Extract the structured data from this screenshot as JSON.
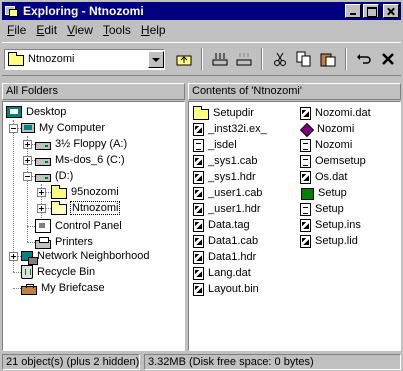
{
  "window": {
    "title": "Exploring - Ntnozomi"
  },
  "menu": [
    {
      "label": "File",
      "key": "F",
      "rest": "ile"
    },
    {
      "label": "Edit",
      "key": "E",
      "rest": "dit"
    },
    {
      "label": "View",
      "key": "V",
      "rest": "iew"
    },
    {
      "label": "Tools",
      "key": "T",
      "rest": "ools"
    },
    {
      "label": "Help",
      "key": "H",
      "rest": "elp"
    }
  ],
  "toolbar": {
    "location": "Ntnozomi",
    "buttons": [
      "up-folder-icon",
      "map-drive-icon",
      "disconnect-drive-icon",
      "cut-icon",
      "copy-icon",
      "paste-icon",
      "undo-icon",
      "delete-icon"
    ]
  },
  "panes": {
    "left_header": "All Folders",
    "right_header": "Contents of 'Ntnozomi'"
  },
  "tree": [
    {
      "label": "Desktop",
      "icon": "desktop"
    },
    {
      "label": "My Computer",
      "icon": "computer"
    },
    {
      "label": "3½ Floppy (A:)",
      "icon": "drive"
    },
    {
      "label": "Ms-dos_6 (C:)",
      "icon": "drive"
    },
    {
      "label": "(D:)",
      "icon": "drive"
    },
    {
      "label": "95nozomi",
      "icon": "folder"
    },
    {
      "label": "Ntnozomi",
      "icon": "folder-open"
    },
    {
      "label": "Control Panel",
      "icon": "control-panel"
    },
    {
      "label": "Printers",
      "icon": "printer"
    },
    {
      "label": "Network Neighborhood",
      "icon": "network"
    },
    {
      "label": "Recycle Bin",
      "icon": "recycle-bin"
    },
    {
      "label": "My Briefcase",
      "icon": "briefcase"
    }
  ],
  "files_col1": [
    {
      "name": "Setupdir",
      "icon": "folder"
    },
    {
      "name": "_inst32i.ex_",
      "icon": "document"
    },
    {
      "name": "_isdel",
      "icon": "document"
    },
    {
      "name": "_sys1.cab",
      "icon": "document"
    },
    {
      "name": "_sys1.hdr",
      "icon": "document"
    },
    {
      "name": "_user1.cab",
      "icon": "document"
    },
    {
      "name": "_user1.hdr",
      "icon": "document"
    },
    {
      "name": "Data.tag",
      "icon": "document"
    },
    {
      "name": "Data1.cab",
      "icon": "document"
    },
    {
      "name": "Data1.hdr",
      "icon": "document"
    },
    {
      "name": "Lang.dat",
      "icon": "document"
    },
    {
      "name": "Layout.bin",
      "icon": "document"
    }
  ],
  "files_col2": [
    {
      "name": "Nozomi.dat",
      "icon": "document"
    },
    {
      "name": "Nozomi",
      "icon": "diamond"
    },
    {
      "name": "Nozomi",
      "icon": "document"
    },
    {
      "name": "Oemsetup",
      "icon": "document"
    },
    {
      "name": "Os.dat",
      "icon": "document"
    },
    {
      "name": "Setup",
      "icon": "setup-exe"
    },
    {
      "name": "Setup",
      "icon": "document"
    },
    {
      "name": "Setup.ins",
      "icon": "document"
    },
    {
      "name": "Setup.lid",
      "icon": "document"
    }
  ],
  "status": {
    "objects": "21 object(s) (plus 2 hidden)",
    "disk": "3.32MB (Disk free space: 0 bytes)"
  }
}
